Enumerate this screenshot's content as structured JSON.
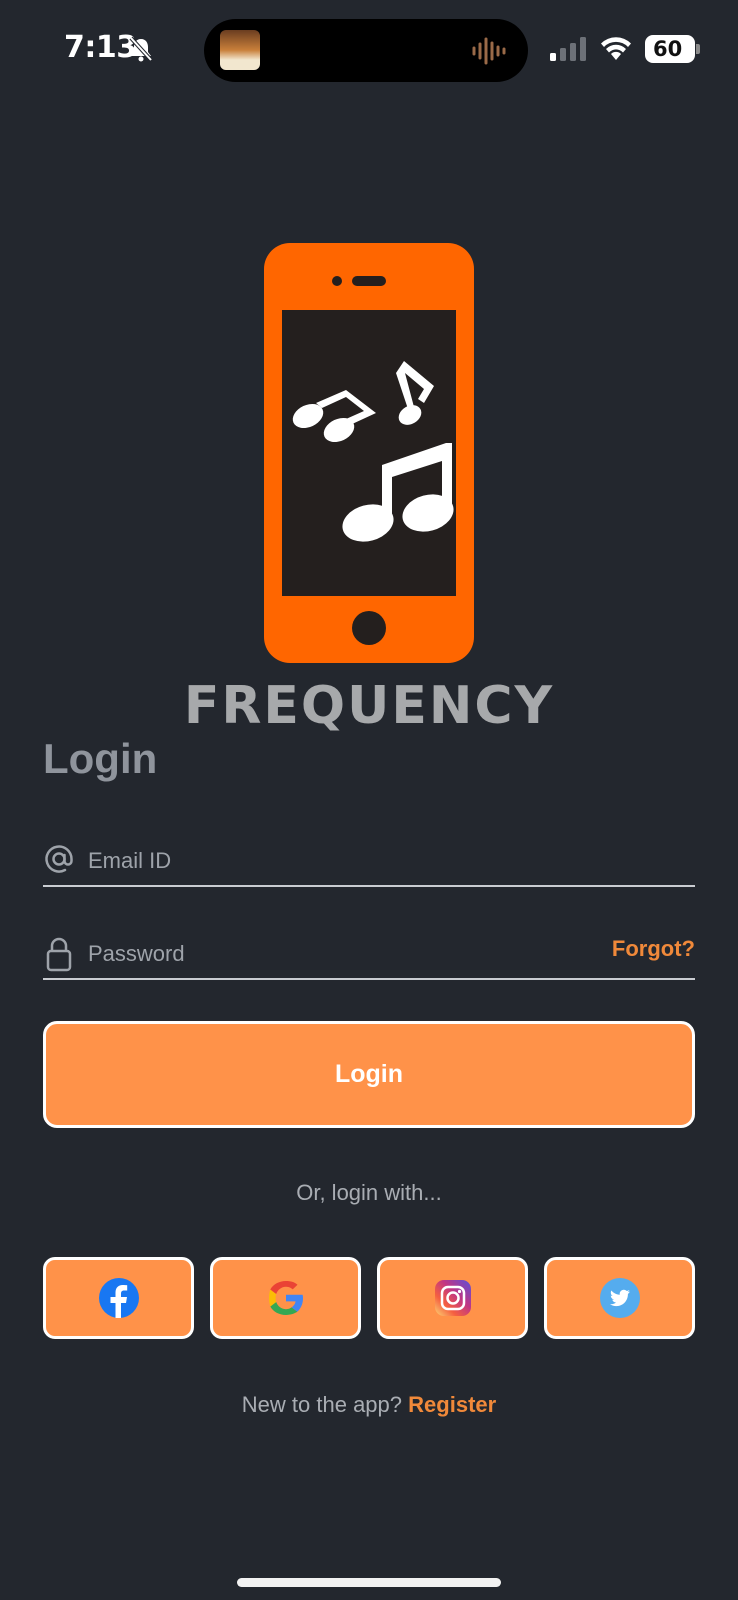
{
  "status_bar": {
    "time": "7:13",
    "battery": "60"
  },
  "app": {
    "brand_name": "FREQUENCY",
    "accent_color": "#ff9249",
    "logo_color": "#ff6600",
    "background_color": "#23272e"
  },
  "login": {
    "heading": "Login",
    "email_placeholder": "Email ID",
    "password_placeholder": "Password",
    "forgot_label": "Forgot?",
    "login_button": "Login",
    "or_text": "Or, login with...",
    "social": [
      "facebook-icon",
      "google-icon",
      "instagram-icon",
      "twitter-icon"
    ],
    "register_prompt": "New to the app?",
    "register_link": "Register"
  }
}
